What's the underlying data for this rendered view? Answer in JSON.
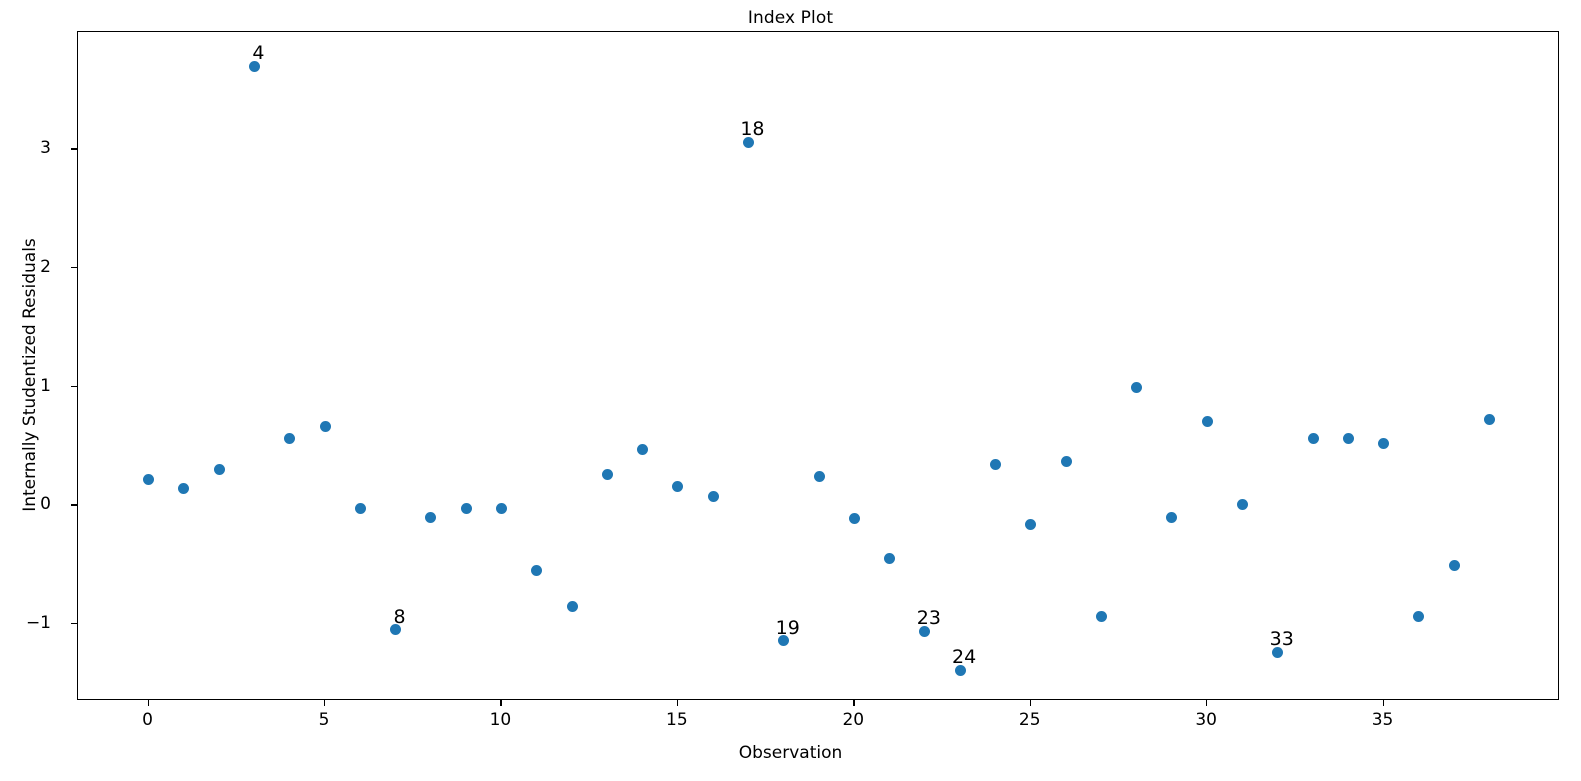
{
  "chart_data": {
    "type": "scatter",
    "title": "Index Plot",
    "xlabel": "Observation",
    "ylabel": "Internally Studentized Residuals",
    "grid": false,
    "legend": "none",
    "marker_color": "#1f77b4",
    "xlim": [
      -2.0,
      40.0
    ],
    "ylim": [
      -1.65,
      3.99
    ],
    "xticks": [
      0,
      5,
      10,
      15,
      20,
      25,
      30,
      35
    ],
    "xtick_labels": [
      "0",
      "5",
      "10",
      "15",
      "20",
      "25",
      "30",
      "35"
    ],
    "yticks": [
      -1,
      0,
      1,
      2,
      3
    ],
    "ytick_labels": [
      "−1",
      "0",
      "1",
      "2",
      "3"
    ],
    "x": [
      0,
      1,
      2,
      3,
      4,
      5,
      6,
      7,
      8,
      9,
      10,
      11,
      12,
      13,
      14,
      15,
      16,
      17,
      18,
      19,
      20,
      21,
      22,
      23,
      24,
      25,
      26,
      27,
      28,
      29,
      30,
      31,
      32,
      33,
      34,
      35,
      36,
      37,
      38
    ],
    "values": [
      0.22,
      0.14,
      0.3,
      3.7,
      0.56,
      0.66,
      -0.03,
      -1.05,
      -0.1,
      -0.03,
      -0.03,
      -0.55,
      -0.85,
      0.26,
      0.47,
      0.16,
      0.07,
      3.06,
      -1.14,
      0.24,
      -0.11,
      -0.45,
      -1.06,
      -1.39,
      0.34,
      -0.16,
      0.37,
      -0.94,
      0.99,
      -0.1,
      0.71,
      0.01,
      -1.24,
      0.56,
      0.56,
      0.52,
      -0.94,
      -0.51,
      0.72
    ],
    "annotations": [
      {
        "label": "4",
        "x": 3,
        "y": 3.7
      },
      {
        "label": "8",
        "x": 7,
        "y": -1.05
      },
      {
        "label": "18",
        "x": 17,
        "y": 3.06
      },
      {
        "label": "19",
        "x": 18,
        "y": -1.14
      },
      {
        "label": "23",
        "x": 22,
        "y": -1.06
      },
      {
        "label": "24",
        "x": 23,
        "y": -1.39
      },
      {
        "label": "33",
        "x": 32,
        "y": -1.24
      }
    ]
  }
}
